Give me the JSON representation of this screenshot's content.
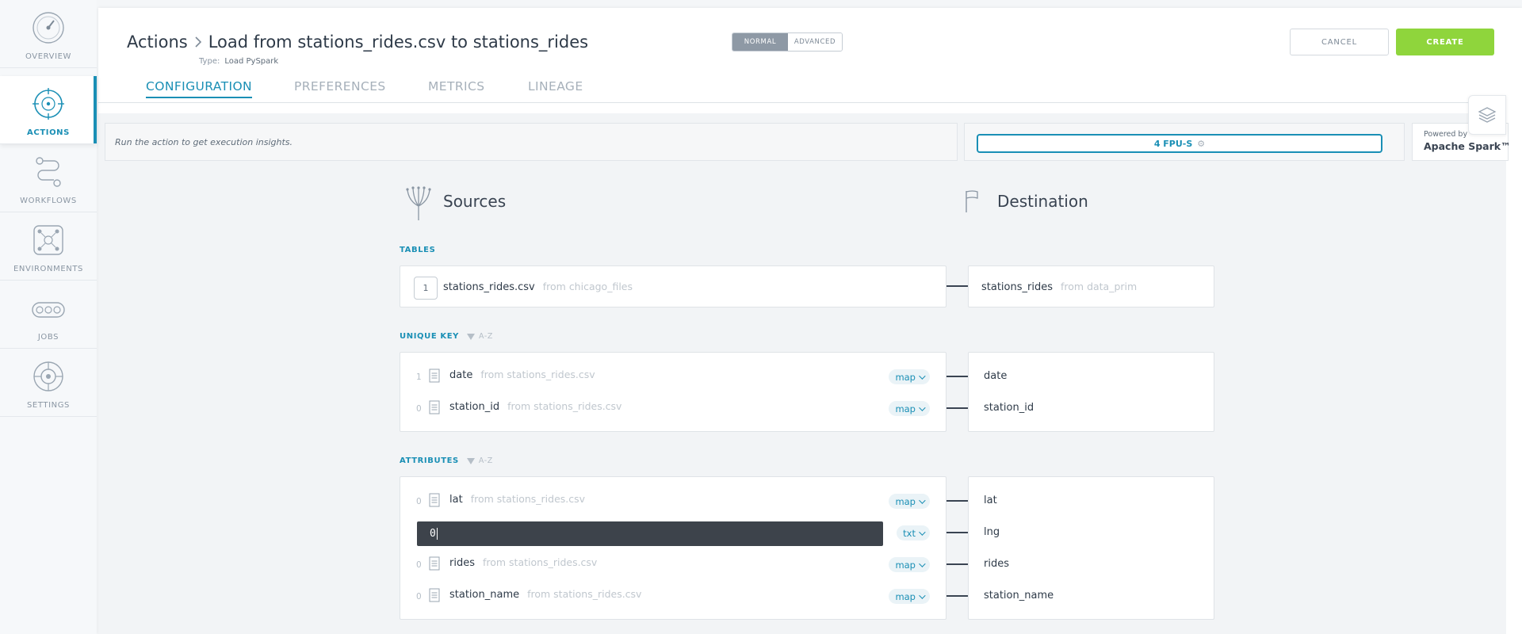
{
  "sidebar": {
    "items": [
      {
        "label": "OVERVIEW",
        "icon": "speedometer-icon"
      },
      {
        "label": "ACTIONS",
        "icon": "target-icon",
        "active": true
      },
      {
        "label": "WORKFLOWS",
        "icon": "workflow-icon"
      },
      {
        "label": "ENVIRONMENTS",
        "icon": "network-icon"
      },
      {
        "label": "JOBS",
        "icon": "jobs-icon"
      },
      {
        "label": "SETTINGS",
        "icon": "gear-icon"
      }
    ]
  },
  "header": {
    "breadcrumb_root": "Actions",
    "title": "Load from stations_rides.csv to stations_rides",
    "type_label": "Type:",
    "type_value": "Load PySpark",
    "mode_normal": "NORMAL",
    "mode_advanced": "ADVANCED",
    "cancel_label": "CANCEL",
    "create_label": "CREATE"
  },
  "tabs": [
    "CONFIGURATION",
    "PREFERENCES",
    "METRICS",
    "LINEAGE"
  ],
  "info": {
    "insight": "Run the action to get execution insights.",
    "fpu": "4 FPU-S",
    "powered_by": "Powered by",
    "engine": "Apache Spark™"
  },
  "sources": {
    "title": "Sources",
    "tables_label": "TABLES",
    "table": {
      "index": "1",
      "name": "stations_rides.csv",
      "from": "from chicago_files"
    },
    "unique_key_label": "UNIQUE KEY",
    "attributes_label": "ATTRIBUTES",
    "sort_label": "A-Z",
    "unique_key": [
      {
        "idx": "1",
        "name": "date",
        "from": "from stations_rides.csv",
        "mode": "map"
      },
      {
        "idx": "0",
        "name": "station_id",
        "from": "from stations_rides.csv",
        "mode": "map"
      }
    ],
    "attributes": [
      {
        "idx": "0",
        "name": "lat",
        "from": "from stations_rides.csv",
        "mode": "map"
      },
      {
        "editing": true,
        "value": "0",
        "mode": "txt"
      },
      {
        "idx": "0",
        "name": "rides",
        "from": "from stations_rides.csv",
        "mode": "map"
      },
      {
        "idx": "0",
        "name": "station_name",
        "from": "from stations_rides.csv",
        "mode": "map"
      }
    ]
  },
  "destination": {
    "title": "Destination",
    "table": {
      "name": "stations_rides",
      "from": "from data_prim"
    },
    "unique_key": [
      "date",
      "station_id"
    ],
    "attributes": [
      "lat",
      "lng",
      "rides",
      "station_name"
    ]
  },
  "colors": {
    "accent": "#1a8fb5",
    "create": "#8fd53c",
    "input_dark": "#3d434b"
  }
}
